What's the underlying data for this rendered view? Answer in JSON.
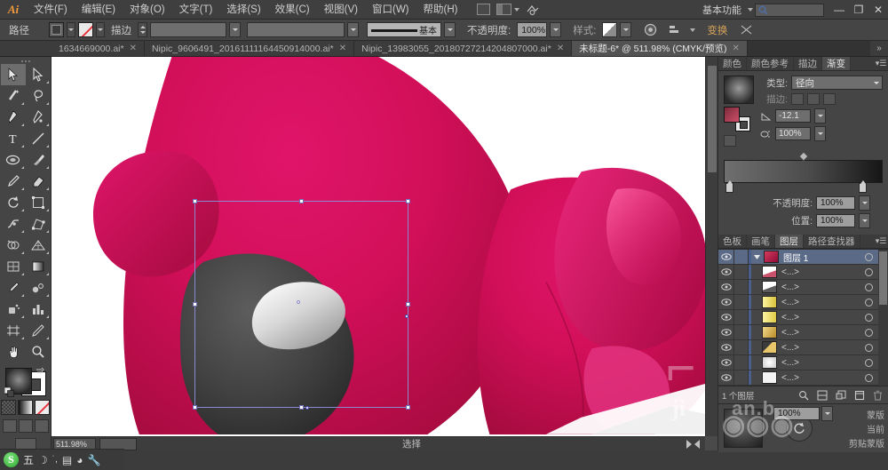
{
  "app": {
    "name": "Ai",
    "workspace": "基本功能",
    "search_placeholder": ""
  },
  "menubar": {
    "items": [
      {
        "label": "文件(F)"
      },
      {
        "label": "编辑(E)"
      },
      {
        "label": "对象(O)"
      },
      {
        "label": "文字(T)"
      },
      {
        "label": "选择(S)"
      },
      {
        "label": "效果(C)"
      },
      {
        "label": "视图(V)"
      },
      {
        "label": "窗口(W)"
      },
      {
        "label": "帮助(H)"
      }
    ],
    "window_buttons": {
      "minimize": "—",
      "restore": "❐",
      "close": "✕"
    }
  },
  "controlbar": {
    "selection_label": "路径",
    "stroke_label": "描边",
    "stroke_profile": "基本",
    "opacity_label": "不透明度:",
    "opacity_value": "100%",
    "style_label": "样式:",
    "align_label": "对齐",
    "transform_label": "变换"
  },
  "tabs": {
    "items": [
      {
        "label": "1634669000.ai*",
        "active": false
      },
      {
        "label": "Nipic_9606491_20161111164450914000.ai*",
        "active": false
      },
      {
        "label": "Nipic_13983055_20180727214204807000.ai*",
        "active": false
      },
      {
        "label": "未标题-6* @ 511.98% (CMYK/预览)",
        "active": true
      }
    ],
    "overflow": "»"
  },
  "toolbar": {
    "tools": [
      {
        "name": "selection-tool",
        "selected": true
      },
      {
        "name": "direct-selection-tool",
        "selected": false
      },
      {
        "name": "magic-wand-tool",
        "selected": false
      },
      {
        "name": "lasso-tool",
        "selected": false
      },
      {
        "name": "pen-tool",
        "selected": false
      },
      {
        "name": "curvature-tool",
        "selected": false
      },
      {
        "name": "type-tool",
        "selected": false
      },
      {
        "name": "line-segment-tool",
        "selected": false
      },
      {
        "name": "ellipse-tool",
        "selected": false
      },
      {
        "name": "paintbrush-tool",
        "selected": false
      },
      {
        "name": "pencil-tool",
        "selected": false
      },
      {
        "name": "eraser-tool",
        "selected": false
      },
      {
        "name": "rotate-tool",
        "selected": false
      },
      {
        "name": "scale-tool",
        "selected": false
      },
      {
        "name": "width-tool",
        "selected": false
      },
      {
        "name": "free-transform-tool",
        "selected": false
      },
      {
        "name": "shape-builder-tool",
        "selected": false
      },
      {
        "name": "perspective-grid-tool",
        "selected": false
      },
      {
        "name": "mesh-tool",
        "selected": false
      },
      {
        "name": "gradient-tool",
        "selected": false
      },
      {
        "name": "eyedropper-tool",
        "selected": false
      },
      {
        "name": "blend-tool",
        "selected": false
      },
      {
        "name": "symbol-sprayer-tool",
        "selected": false
      },
      {
        "name": "column-graph-tool",
        "selected": false
      },
      {
        "name": "artboard-tool",
        "selected": false
      },
      {
        "name": "slice-tool",
        "selected": false
      },
      {
        "name": "hand-tool",
        "selected": false
      },
      {
        "name": "zoom-tool",
        "selected": false
      }
    ]
  },
  "gradient_panel": {
    "tabs": [
      {
        "label": "颜色",
        "active": false
      },
      {
        "label": "颜色参考",
        "active": false
      },
      {
        "label": "描边",
        "active": false
      },
      {
        "label": "渐变",
        "active": true
      }
    ],
    "type_label": "类型:",
    "type_value": "径向",
    "stroke_label": "描边:",
    "angle_value": "-12.1",
    "aspect_value": "100%",
    "opacity_label": "不透明度:",
    "opacity_value": "100%",
    "location_label": "位置:",
    "location_value": "100%",
    "gradient_colors": [
      "#6f6f6f",
      "#161616"
    ]
  },
  "layers_panel": {
    "tabs": [
      {
        "label": "色板",
        "active": false
      },
      {
        "label": "画笔",
        "active": false
      },
      {
        "label": "图层",
        "active": true
      },
      {
        "label": "路径查找器",
        "active": false
      }
    ],
    "rows": [
      {
        "name": "图层 1",
        "type": "layer",
        "selected": true,
        "thumb": "#c4364f"
      },
      {
        "name": "<...>",
        "type": "path",
        "selected": false,
        "thumb": "#f0f0f0"
      },
      {
        "name": "<...>",
        "type": "path",
        "selected": false,
        "thumb": "#f0f0f0"
      },
      {
        "name": "<...>",
        "type": "path",
        "selected": false,
        "thumb": "#f2e45a"
      },
      {
        "name": "<...>",
        "type": "path",
        "selected": false,
        "thumb": "#f2e45a"
      },
      {
        "name": "<...>",
        "type": "path",
        "selected": false,
        "thumb": "#d6a83a"
      },
      {
        "name": "<...>",
        "type": "path",
        "selected": false,
        "thumb": "#caa044"
      },
      {
        "name": "<...>",
        "type": "path",
        "selected": false,
        "thumb": "#d8d8d8"
      },
      {
        "name": "<...>",
        "type": "path",
        "selected": false,
        "thumb": "#ededed"
      }
    ],
    "footer": {
      "count_text": "1 个图层",
      "buttons": [
        "locate-object",
        "make-clipping-mask",
        "create-new-sublayer",
        "create-new-layer",
        "delete-selection"
      ]
    }
  },
  "bottom_panel": {
    "opacity_value": "100%",
    "label_top": "蒙版",
    "label_mid": "当前",
    "label_bottom": "剪贴蒙版"
  },
  "statusbar": {
    "zoom_value": "511.98%",
    "tool_text": "选择"
  },
  "canvas": {
    "background": "#ffffff",
    "body_color": "#cf0c51",
    "body_shadow": "#9c0b3c",
    "eye_dark": "#3a3a3a",
    "highlight": "#f5f5f5",
    "watermark_1": "ji",
    "watermark_2": "an.b"
  },
  "ime": {
    "engine": "S",
    "mode": "五",
    "items": [
      "moon-icon",
      "comma-icon",
      "keyboard-icon",
      "palette-icon",
      "wrench-icon"
    ]
  }
}
